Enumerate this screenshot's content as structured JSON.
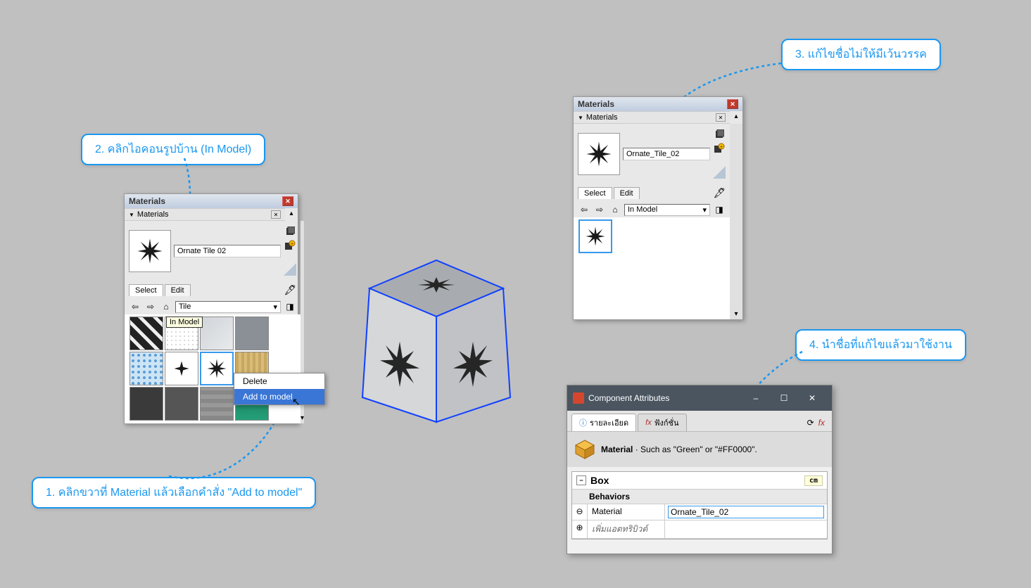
{
  "callouts": {
    "c1": "1. คลิกขวาที่ Material แล้วเลือกคำสั่ง \"Add to model\"",
    "c2": "2. คลิกไอคอนรูปบ้าน (In Model)",
    "c3": "3. แก้ไขชื่อไม่ให้มีเว้นวรรค",
    "c4": "4. นำชื่อที่แก้ไขแล้วมาใช้งาน"
  },
  "materials_panel_1": {
    "title": "Materials",
    "subtitle": "Materials",
    "material_name": "Ornate Tile 02",
    "tabs": {
      "select": "Select",
      "edit": "Edit"
    },
    "dropdown": "Tile",
    "tooltip": "In Model",
    "context_menu": {
      "delete": "Delete",
      "add": "Add to model"
    }
  },
  "materials_panel_2": {
    "title": "Materials",
    "subtitle": "Materials",
    "material_name": "Ornate_Tile_02",
    "tabs": {
      "select": "Select",
      "edit": "Edit"
    },
    "dropdown": "In Model"
  },
  "component_attributes": {
    "title": "Component Attributes",
    "tab1": "รายละเอียด",
    "tab2": "ฟังก์ชั่น",
    "desc_label": "Material",
    "desc_text": " · Such as \"Green\" or \"#FF0000\".",
    "entity": "Box",
    "unit": "cm",
    "section": "Behaviors",
    "attr_name": "Material",
    "attr_value": "Ornate_Tile_02",
    "add_attr": "เพิ่มแอตทริบิวต์"
  }
}
